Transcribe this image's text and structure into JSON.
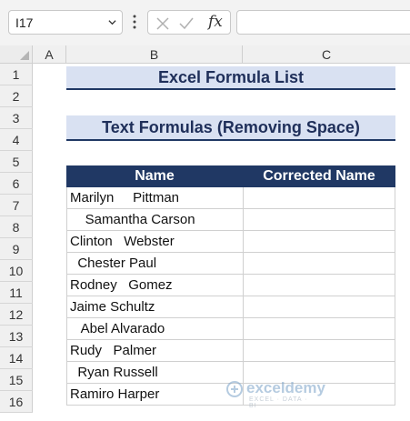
{
  "formula_bar": {
    "name_box": "I17",
    "fx_label": "fx",
    "formula": ""
  },
  "columns": [
    "A",
    "B",
    "C"
  ],
  "rows": [
    "1",
    "2",
    "3",
    "4",
    "5",
    "6",
    "7",
    "8",
    "9",
    "10",
    "11",
    "12",
    "13",
    "14",
    "15",
    "16"
  ],
  "sheet": {
    "title": "Excel Formula List",
    "subtitle": "Text Formulas (Removing Space)",
    "table": {
      "headers": [
        "Name",
        "Corrected Name"
      ],
      "names": [
        "Marilyn     Pittman",
        "    Samantha Carson",
        "Clinton   Webster",
        "  Chester Paul",
        "Rodney   Gomez",
        "Jaime Schultz",
        "   Abel Alvarado",
        "Rudy   Palmer",
        "  Ryan Russell",
        "Ramiro Harper"
      ],
      "corrected": [
        "",
        "",
        "",
        "",
        "",
        "",
        "",
        "",
        "",
        ""
      ]
    }
  },
  "watermark": {
    "name": "exceldemy",
    "tagline": "EXCEL · DATA · BI"
  },
  "colors": {
    "band_fill": "#d9e1f2",
    "header_fill": "#203864",
    "title_text": "#1f2f5a"
  }
}
